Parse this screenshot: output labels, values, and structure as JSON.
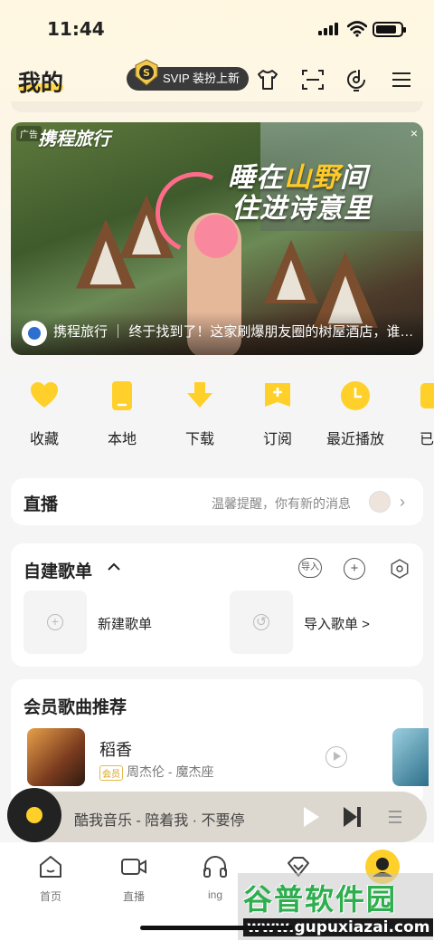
{
  "status_bar": {
    "time": "11:44"
  },
  "header": {
    "title": "我的",
    "svip_label": "SVIP 装扮上新"
  },
  "banner": {
    "ad_tag": "广告",
    "brand": "携程旅行",
    "slogan_line1_pre": "睡在",
    "slogan_line1_hl": "山野",
    "slogan_line1_post": "间",
    "slogan_line2": "住进诗意里",
    "caption": "携程旅行 ｜ 终于找到了！这家刷爆朋友圈的树屋酒店，谁…",
    "close": "×"
  },
  "shortcuts": [
    {
      "label": "收藏",
      "icon": "heart-icon"
    },
    {
      "label": "本地",
      "icon": "phone-icon"
    },
    {
      "label": "下载",
      "icon": "download-icon"
    },
    {
      "label": "订阅",
      "icon": "subscribe-icon"
    },
    {
      "label": "最近播放",
      "icon": "clock-icon"
    },
    {
      "label": "已",
      "icon": "check-icon"
    }
  ],
  "live": {
    "title": "直播",
    "message": "温馨提醒，你有新的消息"
  },
  "playlists": {
    "title": "自建歌单",
    "import_icon_label": "导入",
    "new_label": "新建歌单",
    "import_label": "导入歌单 >"
  },
  "members": {
    "title": "会员歌曲推荐",
    "song": {
      "title": "稻香",
      "vip_tag": "会员",
      "artist_album": "周杰伦 - 魔杰座"
    }
  },
  "player": {
    "text": "酷我音乐 - 陪着我 · 不要停"
  },
  "tabs": [
    {
      "label": "首页",
      "icon": "home-icon"
    },
    {
      "label": "直播",
      "icon": "video-icon"
    },
    {
      "label": "ing",
      "icon": "headphones-icon"
    },
    {
      "label": "",
      "icon": "diamond-icon"
    },
    {
      "label": "",
      "icon": "me-icon"
    }
  ],
  "watermark": {
    "name": "谷普软件园",
    "url": "www.gupuxiazai.com"
  },
  "colors": {
    "accent": "#ffd02a",
    "background": "#f5f5f5",
    "header_gradient": "#fff7e0"
  }
}
